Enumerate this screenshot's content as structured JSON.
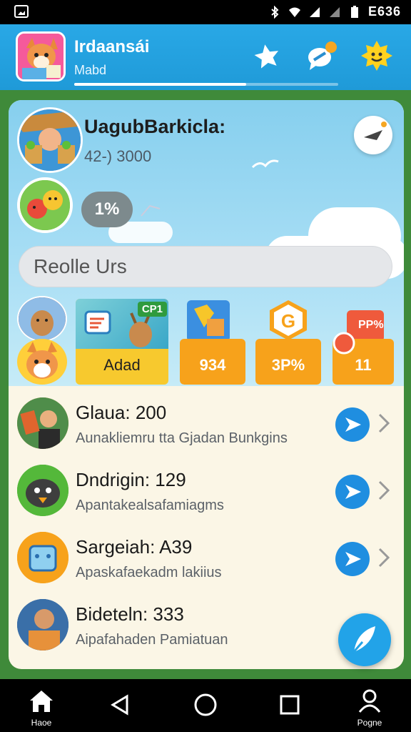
{
  "status_bar": {
    "time": "E636"
  },
  "header": {
    "title": "Irdaansái",
    "subtitle": "Mabd",
    "progress": 0.65,
    "icons": [
      "star-icon",
      "chat-icon",
      "sun-badge-icon"
    ]
  },
  "profile": {
    "name": "UagubBarkicla:",
    "stat": "42-) 3000",
    "percent": "1%"
  },
  "search": {
    "placeholder": "Reolle Urs"
  },
  "tiles": [
    {
      "label": "Adad",
      "badge": "CP1",
      "color": "#f7c92e"
    },
    {
      "label": "934",
      "badge": "",
      "color": "#f7a21b"
    },
    {
      "label": "3P%",
      "badge": "",
      "color": "#f7a21b"
    },
    {
      "label": "11",
      "badge": "PP%",
      "color": "#f7a21b"
    }
  ],
  "list": [
    {
      "title": "Glaua: 200",
      "subtitle": "Aunakliemru tta Gjadan Bunkgins"
    },
    {
      "title": "Dndrigin: 129",
      "subtitle": "Apantakealsafamiagms"
    },
    {
      "title": "Sargeiah: A39",
      "subtitle": "Apaskafaekadm lakiius"
    },
    {
      "title": "Bideteln: 333",
      "subtitle": "Aipafahaden Pamiatuan"
    }
  ],
  "nav": [
    {
      "label": "Haoe",
      "icon": "home-icon"
    },
    {
      "label": "",
      "icon": "back-icon"
    },
    {
      "label": "",
      "icon": "circle-home-icon"
    },
    {
      "label": "",
      "icon": "recents-icon"
    },
    {
      "label": "Pogne",
      "icon": "profile-icon"
    }
  ],
  "colors": {
    "header": "#1f9ad8",
    "accent": "#1f8ee0",
    "tile": "#f7a21b"
  }
}
